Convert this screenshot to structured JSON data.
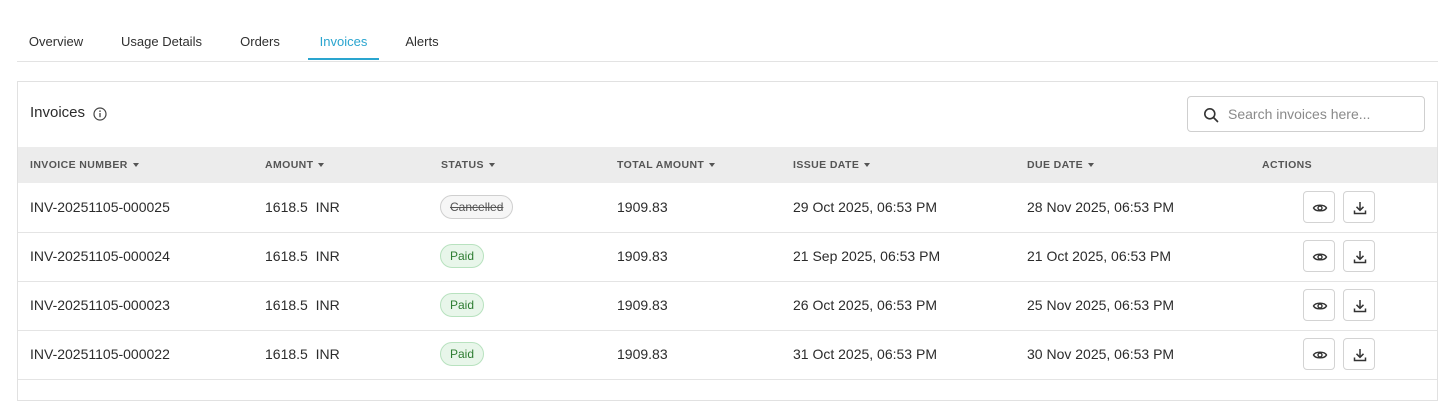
{
  "tabs": [
    {
      "label": "Overview",
      "active": false
    },
    {
      "label": "Usage Details",
      "active": false
    },
    {
      "label": "Orders",
      "active": false
    },
    {
      "label": "Invoices",
      "active": true
    },
    {
      "label": "Alerts",
      "active": false
    }
  ],
  "card": {
    "title": "Invoices",
    "title_icon": "info-icon",
    "search": {
      "placeholder": "Search invoices here...",
      "value": "",
      "icon": "search-icon"
    }
  },
  "table": {
    "columns": [
      "INVOICE NUMBER",
      "AMOUNT",
      "STATUS",
      "TOTAL AMOUNT",
      "ISSUE DATE",
      "DUE DATE",
      "ACTIONS"
    ],
    "rows": [
      {
        "invoice_number": "INV-20251105-000025",
        "amount": "1618.5  INR",
        "status": "Cancelled",
        "total_amount": "1909.83",
        "issue_date": "29 Oct 2025, 06:53 PM",
        "due_date": "28 Nov 2025, 06:53 PM"
      },
      {
        "invoice_number": "INV-20251105-000024",
        "amount": "1618.5  INR",
        "status": "Paid",
        "total_amount": "1909.83",
        "issue_date": "21 Sep 2025, 06:53 PM",
        "due_date": "21 Oct 2025, 06:53 PM"
      },
      {
        "invoice_number": "INV-20251105-000023",
        "amount": "1618.5  INR",
        "status": "Paid",
        "total_amount": "1909.83",
        "issue_date": "26 Oct 2025, 06:53 PM",
        "due_date": "25 Nov 2025, 06:53 PM"
      },
      {
        "invoice_number": "INV-20251105-000022",
        "amount": "1618.5  INR",
        "status": "Paid",
        "total_amount": "1909.83",
        "issue_date": "31 Oct 2025, 06:53 PM",
        "due_date": "30 Nov 2025, 06:53 PM"
      }
    ],
    "actions": {
      "view_icon": "eye-icon",
      "download_icon": "download-icon"
    }
  },
  "colors": {
    "accent": "#2aa5cf",
    "header_bg": "#ececec",
    "paid_bg": "#e8f6ea",
    "paid_text": "#2e7d32",
    "cancelled_border": "#cfcfcf"
  }
}
